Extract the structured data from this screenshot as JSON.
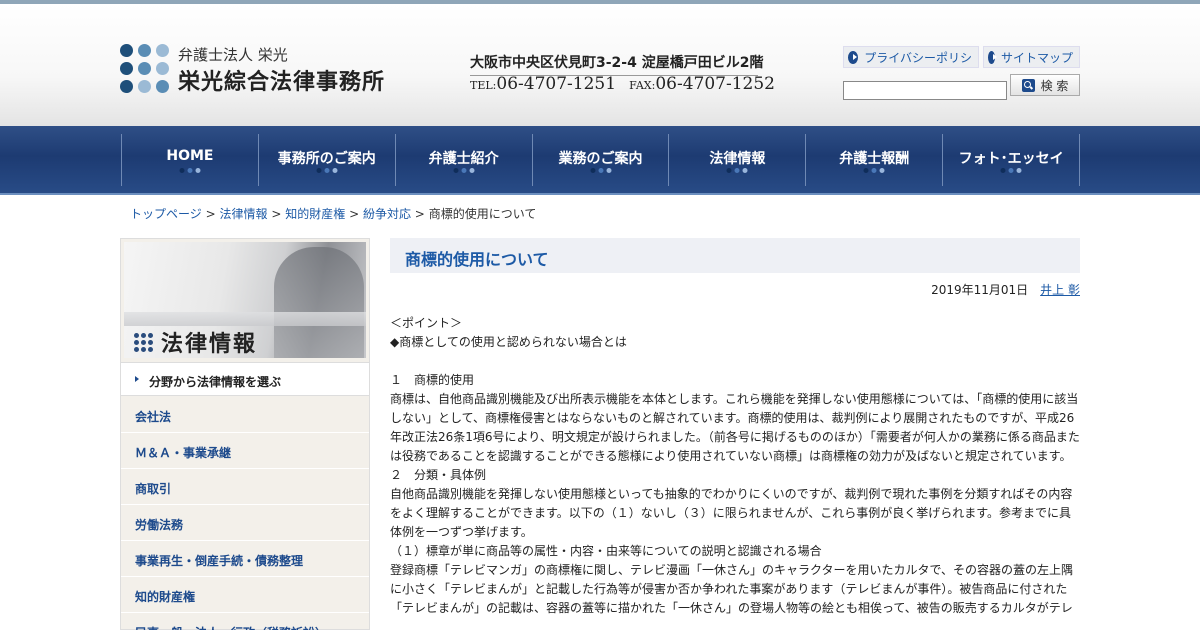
{
  "header": {
    "logo_sub": "弁護士法人 栄光",
    "logo_main": "栄光綜合法律事務所",
    "address": "大阪市中央区伏見町3-2-4 淀屋橋戸田ビル2階",
    "tel_label": "TEL:",
    "tel": "06-4707-1251",
    "fax_label": "FAX:",
    "fax": "06-4707-1252",
    "privacy_label": "プライバシーポリシ",
    "sitemap_label": "サイトマップ",
    "search_button": "検 索",
    "search_value": ""
  },
  "nav": {
    "items": [
      {
        "label": "HOME"
      },
      {
        "label": "事務所のご案内"
      },
      {
        "label": "弁護士紹介"
      },
      {
        "label": "業務のご案内"
      },
      {
        "label": "法律情報"
      },
      {
        "label": "弁護士報酬"
      },
      {
        "label": "フォト･エッセイ"
      }
    ],
    "dot_colors": [
      "#0f2d5a",
      "#4a78b8",
      "#9ab6dc"
    ]
  },
  "breadcrumb": {
    "items": [
      "トップページ",
      "法律情報",
      "知的財産権",
      "紛争対応"
    ],
    "separator": ">",
    "current": "商標的使用について"
  },
  "sidebar": {
    "hero_title": "法律情報",
    "head": "分野から法律情報を選ぶ",
    "items": [
      {
        "label": "会社法"
      },
      {
        "label": "Ｍ＆Ａ・事業承継"
      },
      {
        "label": "商取引"
      },
      {
        "label": "労働法務"
      },
      {
        "label": "事業再生・倒産手続・債務整理"
      },
      {
        "label": "知的財産権"
      },
      {
        "label": "民事一般・法人・行政（税務訴訟）"
      }
    ]
  },
  "main": {
    "title": "商標的使用について",
    "date": "2019年11月01日",
    "author": "井上 彰",
    "paragraphs": [
      "＜ポイント＞",
      "◆商標としての使用と認められない場合とは",
      "",
      "１　商標的使用",
      "商標は、自他商品識別機能及び出所表示機能を本体とします。これら機能を発揮しない使用態様については、「商標的使用に該当しない」として、商標権侵害とはならないものと解されています。商標的使用は、裁判例により展開されたものですが、平成26年改正法26条1項6号により、明文規定が設けられました。（前各号に掲げるもののほか）「需要者が何人かの業務に係る商品または役務であることを認識することができる態様により使用されていない商標」は商標権の効力が及ばないと規定されています。",
      "２　分類・具体例",
      "自他商品識別機能を発揮しない使用態様といっても抽象的でわかりにくいのですが、裁判例で現れた事例を分類すればその内容をよく理解することができます。以下の（１）ないし（３）に限られませんが、これら事例が良く挙げられます。参考までに具体例を一つずつ挙げます。",
      "（１）標章が単に商品等の属性・内容・由来等についての説明と認識される場合",
      "登録商標「テレビマンガ」の商標権に関し、テレビ漫画「一休さん」のキャラクターを用いたカルタで、その容器の蓋の左上隅に小さく「テレビまんが」と記載した行為等が侵害か否か争われた事案があります（テレビまんが事件）。被告商品に付された「テレビまんが」の記載は、容器の蓋等に描かれた「一休さん」の登場人物等の絵とも相俟って、被告の販売するカルタがテレ"
    ]
  },
  "colors": {
    "accent": "#1d5aa6",
    "nav_bg": "#1d3b72",
    "logo_dots": [
      "#1e4f7a",
      "#5a8db5",
      "#9bbad5"
    ]
  }
}
